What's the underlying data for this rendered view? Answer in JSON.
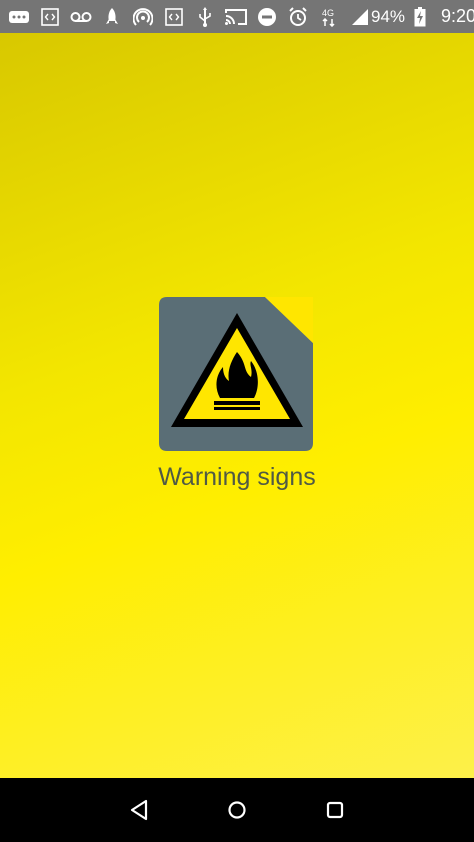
{
  "status_bar": {
    "icons": [
      "more-dots-icon",
      "code-icon",
      "voicemail-icon",
      "rocket-icon",
      "hotspot-icon",
      "code-icon",
      "usb-icon",
      "cast-icon",
      "do-not-disturb-icon",
      "alarm-icon",
      "network-4g-icon",
      "signal-icon"
    ],
    "battery": "94%",
    "time": "9:20"
  },
  "splash": {
    "app_name": "Warning signs",
    "background_colors": [
      "#d8c800",
      "#ffee00",
      "#fdf04a"
    ],
    "icon": {
      "name": "flammable-warning-icon",
      "page_color": "#5a6e76",
      "triangle_color": "#ffe600"
    }
  },
  "nav_bar": {
    "buttons": [
      "back-icon",
      "home-icon",
      "recents-icon"
    ]
  }
}
